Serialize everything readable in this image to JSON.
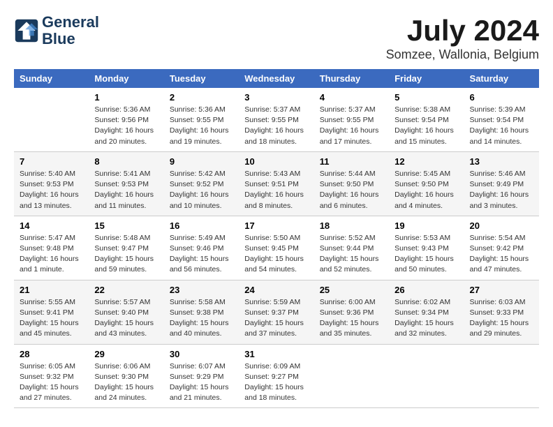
{
  "logo": {
    "line1": "General",
    "line2": "Blue"
  },
  "title": "July 2024",
  "location": "Somzee, Wallonia, Belgium",
  "headers": [
    "Sunday",
    "Monday",
    "Tuesday",
    "Wednesday",
    "Thursday",
    "Friday",
    "Saturday"
  ],
  "weeks": [
    [
      {
        "day": "",
        "text": ""
      },
      {
        "day": "1",
        "text": "Sunrise: 5:36 AM\nSunset: 9:56 PM\nDaylight: 16 hours\nand 20 minutes."
      },
      {
        "day": "2",
        "text": "Sunrise: 5:36 AM\nSunset: 9:55 PM\nDaylight: 16 hours\nand 19 minutes."
      },
      {
        "day": "3",
        "text": "Sunrise: 5:37 AM\nSunset: 9:55 PM\nDaylight: 16 hours\nand 18 minutes."
      },
      {
        "day": "4",
        "text": "Sunrise: 5:37 AM\nSunset: 9:55 PM\nDaylight: 16 hours\nand 17 minutes."
      },
      {
        "day": "5",
        "text": "Sunrise: 5:38 AM\nSunset: 9:54 PM\nDaylight: 16 hours\nand 15 minutes."
      },
      {
        "day": "6",
        "text": "Sunrise: 5:39 AM\nSunset: 9:54 PM\nDaylight: 16 hours\nand 14 minutes."
      }
    ],
    [
      {
        "day": "7",
        "text": "Sunrise: 5:40 AM\nSunset: 9:53 PM\nDaylight: 16 hours\nand 13 minutes."
      },
      {
        "day": "8",
        "text": "Sunrise: 5:41 AM\nSunset: 9:53 PM\nDaylight: 16 hours\nand 11 minutes."
      },
      {
        "day": "9",
        "text": "Sunrise: 5:42 AM\nSunset: 9:52 PM\nDaylight: 16 hours\nand 10 minutes."
      },
      {
        "day": "10",
        "text": "Sunrise: 5:43 AM\nSunset: 9:51 PM\nDaylight: 16 hours\nand 8 minutes."
      },
      {
        "day": "11",
        "text": "Sunrise: 5:44 AM\nSunset: 9:50 PM\nDaylight: 16 hours\nand 6 minutes."
      },
      {
        "day": "12",
        "text": "Sunrise: 5:45 AM\nSunset: 9:50 PM\nDaylight: 16 hours\nand 4 minutes."
      },
      {
        "day": "13",
        "text": "Sunrise: 5:46 AM\nSunset: 9:49 PM\nDaylight: 16 hours\nand 3 minutes."
      }
    ],
    [
      {
        "day": "14",
        "text": "Sunrise: 5:47 AM\nSunset: 9:48 PM\nDaylight: 16 hours\nand 1 minute."
      },
      {
        "day": "15",
        "text": "Sunrise: 5:48 AM\nSunset: 9:47 PM\nDaylight: 15 hours\nand 59 minutes."
      },
      {
        "day": "16",
        "text": "Sunrise: 5:49 AM\nSunset: 9:46 PM\nDaylight: 15 hours\nand 56 minutes."
      },
      {
        "day": "17",
        "text": "Sunrise: 5:50 AM\nSunset: 9:45 PM\nDaylight: 15 hours\nand 54 minutes."
      },
      {
        "day": "18",
        "text": "Sunrise: 5:52 AM\nSunset: 9:44 PM\nDaylight: 15 hours\nand 52 minutes."
      },
      {
        "day": "19",
        "text": "Sunrise: 5:53 AM\nSunset: 9:43 PM\nDaylight: 15 hours\nand 50 minutes."
      },
      {
        "day": "20",
        "text": "Sunrise: 5:54 AM\nSunset: 9:42 PM\nDaylight: 15 hours\nand 47 minutes."
      }
    ],
    [
      {
        "day": "21",
        "text": "Sunrise: 5:55 AM\nSunset: 9:41 PM\nDaylight: 15 hours\nand 45 minutes."
      },
      {
        "day": "22",
        "text": "Sunrise: 5:57 AM\nSunset: 9:40 PM\nDaylight: 15 hours\nand 43 minutes."
      },
      {
        "day": "23",
        "text": "Sunrise: 5:58 AM\nSunset: 9:38 PM\nDaylight: 15 hours\nand 40 minutes."
      },
      {
        "day": "24",
        "text": "Sunrise: 5:59 AM\nSunset: 9:37 PM\nDaylight: 15 hours\nand 37 minutes."
      },
      {
        "day": "25",
        "text": "Sunrise: 6:00 AM\nSunset: 9:36 PM\nDaylight: 15 hours\nand 35 minutes."
      },
      {
        "day": "26",
        "text": "Sunrise: 6:02 AM\nSunset: 9:34 PM\nDaylight: 15 hours\nand 32 minutes."
      },
      {
        "day": "27",
        "text": "Sunrise: 6:03 AM\nSunset: 9:33 PM\nDaylight: 15 hours\nand 29 minutes."
      }
    ],
    [
      {
        "day": "28",
        "text": "Sunrise: 6:05 AM\nSunset: 9:32 PM\nDaylight: 15 hours\nand 27 minutes."
      },
      {
        "day": "29",
        "text": "Sunrise: 6:06 AM\nSunset: 9:30 PM\nDaylight: 15 hours\nand 24 minutes."
      },
      {
        "day": "30",
        "text": "Sunrise: 6:07 AM\nSunset: 9:29 PM\nDaylight: 15 hours\nand 21 minutes."
      },
      {
        "day": "31",
        "text": "Sunrise: 6:09 AM\nSunset: 9:27 PM\nDaylight: 15 hours\nand 18 minutes."
      },
      {
        "day": "",
        "text": ""
      },
      {
        "day": "",
        "text": ""
      },
      {
        "day": "",
        "text": ""
      }
    ]
  ]
}
